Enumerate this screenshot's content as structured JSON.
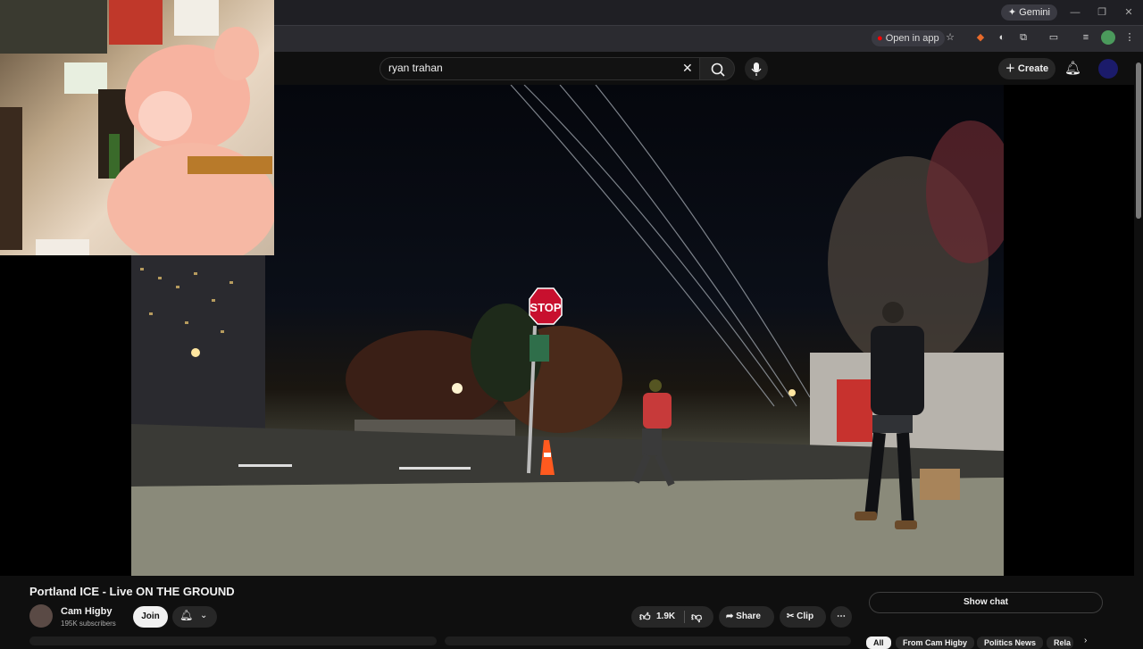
{
  "browser": {
    "gemini_label": "Gemini",
    "open_in_app_label": "Open in app"
  },
  "header": {
    "search_value": "ryan trahan",
    "create_label": "Create"
  },
  "video": {
    "title": "Portland ICE - Live ON THE GROUND",
    "stop_sign_text": "STOP"
  },
  "channel": {
    "name": "Cam Higby",
    "subscribers": "195K subscribers",
    "join_label": "Join"
  },
  "actions": {
    "likes": "1.9K",
    "share_label": "Share",
    "clip_label": "Clip"
  },
  "chat": {
    "show_chat_label": "Show chat"
  },
  "chips": [
    "All",
    "From Cam Higby",
    "Politics News",
    "Rela"
  ],
  "colors": {
    "page_bg": "#0f0f0f",
    "stop_red": "#c8102e",
    "join_bg": "#f1f1f1"
  }
}
